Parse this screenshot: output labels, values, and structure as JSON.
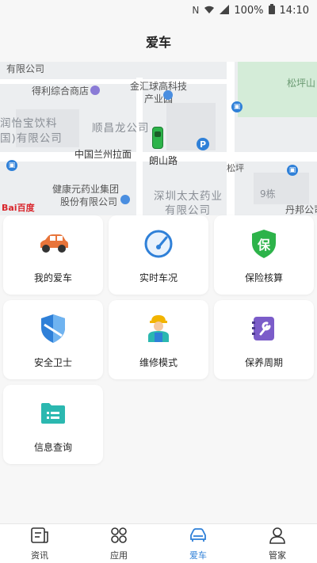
{
  "status_bar": {
    "battery": "100%",
    "time": "14:10",
    "nfc": "N"
  },
  "header": {
    "title": "爱车"
  },
  "map": {
    "labels": {
      "youxian1": "有限公司",
      "deli": "得利综合商店",
      "jinhui": "金汇球高科技",
      "chanyeyuan": "产业园",
      "songping_shan": "松坪山",
      "runyi": "润怡宝饮料",
      "runyi2": "国)有限公司",
      "shunchang": "顺昌龙公司",
      "lanzhou": "中国兰州拉面",
      "langshan": "朗山路",
      "songping": "松坪",
      "jiankang1": "健康元药业集团",
      "jiankang2": "股份有限公司",
      "taitai1": "深圳太太药业",
      "taitai2": "有限公司",
      "jiudong": "9栋",
      "danbang": "丹邦公司"
    },
    "bus_glyph": "▣",
    "parking_glyph": "P",
    "logo": "Bai百度"
  },
  "features": [
    {
      "label": "我的爱车",
      "icon": "car-icon"
    },
    {
      "label": "实时车况",
      "icon": "speedometer-icon"
    },
    {
      "label": "保险核算",
      "icon": "insurance-shield-icon"
    },
    {
      "label": "安全卫士",
      "icon": "security-shield-icon"
    },
    {
      "label": "维修模式",
      "icon": "mechanic-icon"
    },
    {
      "label": "保养周期",
      "icon": "maintenance-book-icon"
    },
    {
      "label": "信息查询",
      "icon": "folder-icon"
    }
  ],
  "insurance_glyph": "保",
  "tabs": [
    {
      "label": "资讯",
      "icon": "news-icon",
      "active": false
    },
    {
      "label": "应用",
      "icon": "apps-icon",
      "active": false
    },
    {
      "label": "爱车",
      "icon": "car-tab-icon",
      "active": true
    },
    {
      "label": "管家",
      "icon": "user-icon",
      "active": false
    }
  ],
  "colors": {
    "accent": "#2f80d8",
    "green": "#2db34a",
    "orange": "#e8743a",
    "teal": "#2bb8b0"
  }
}
